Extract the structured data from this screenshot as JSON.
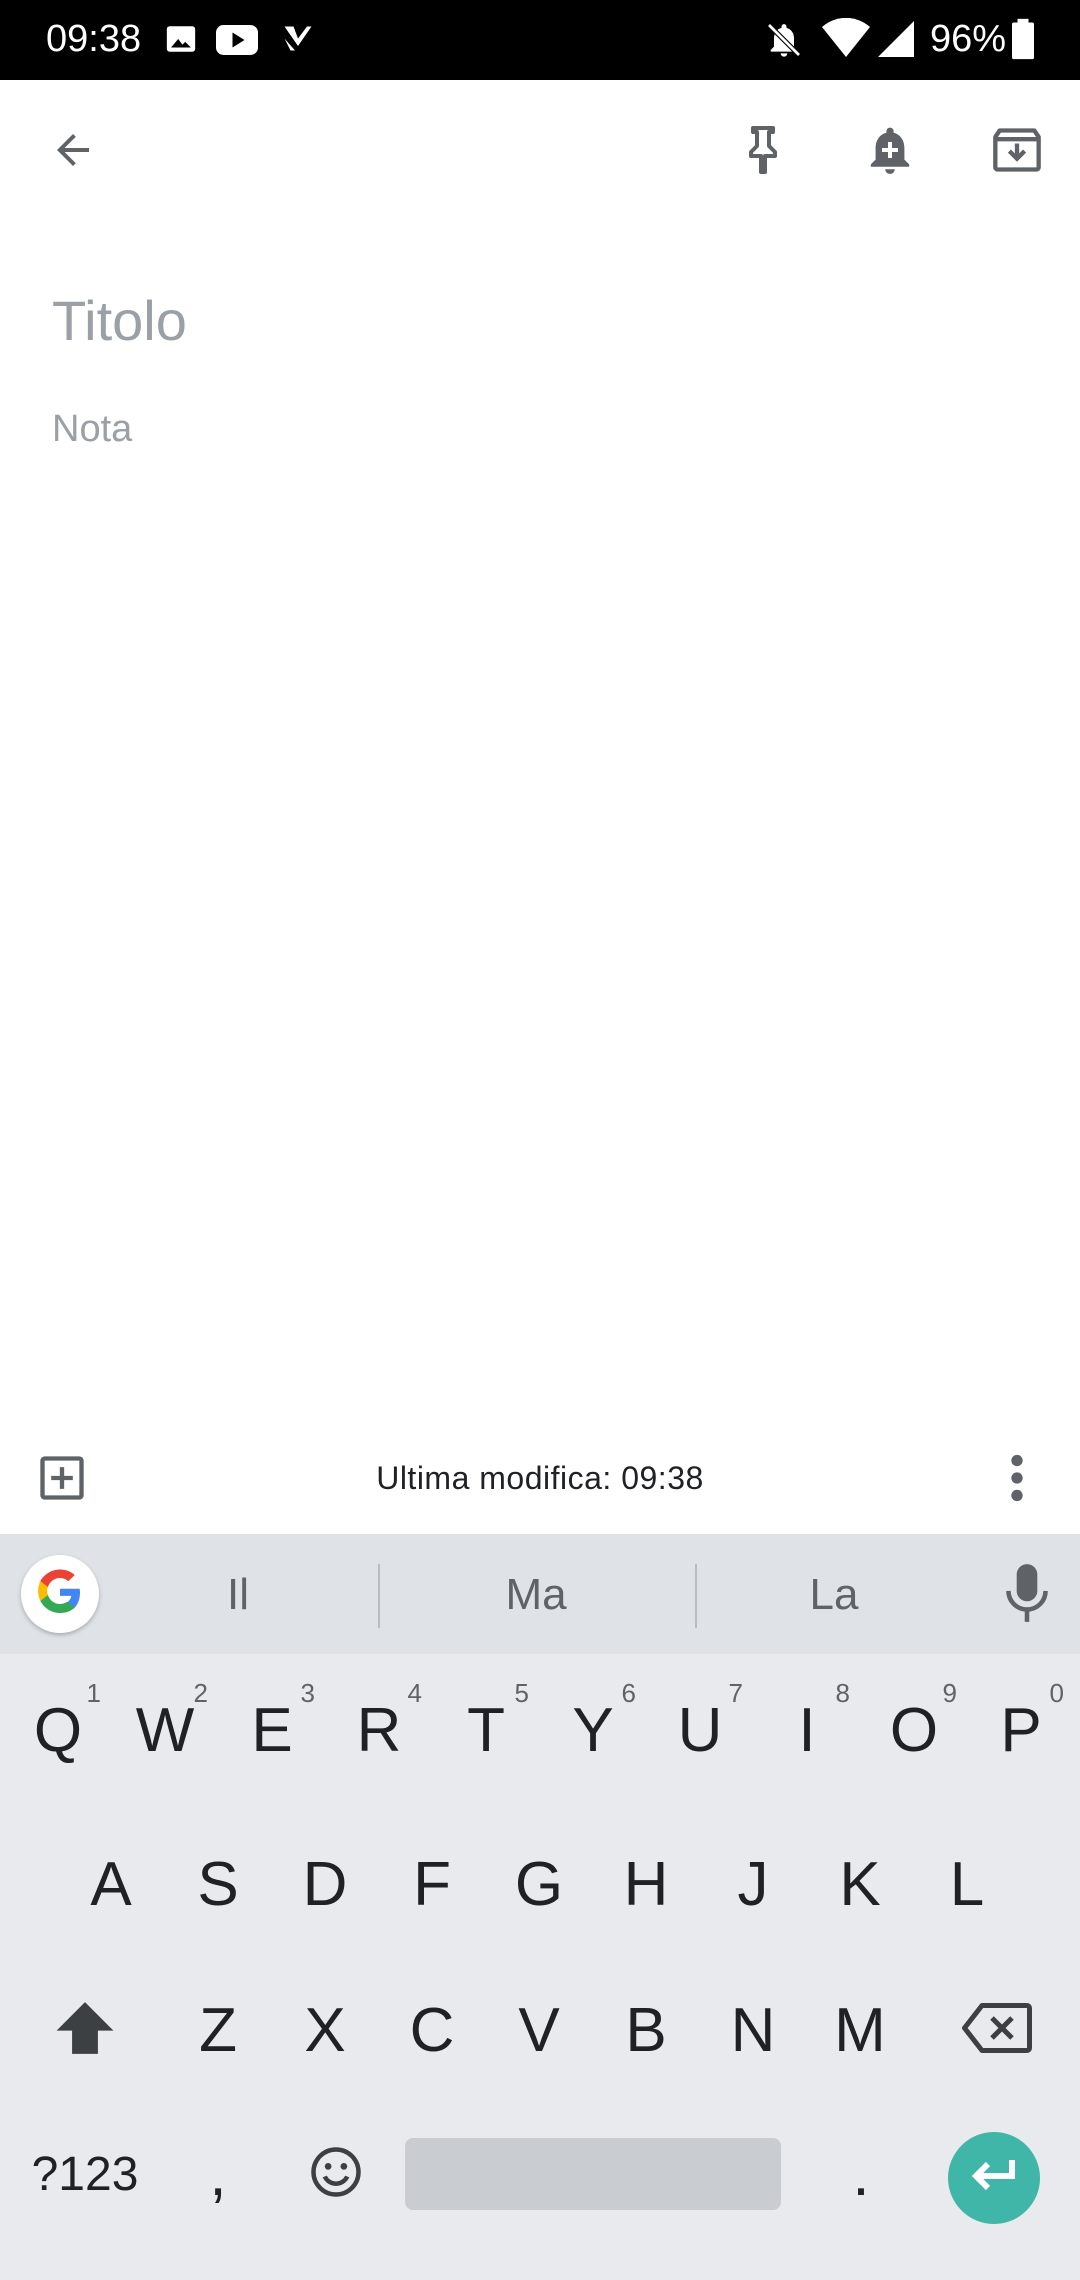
{
  "status_bar": {
    "time": "09:38",
    "battery_percent": "96%",
    "icons": [
      "image-icon",
      "youtube-icon",
      "check-icon",
      "bell-off-icon",
      "wifi-icon",
      "signal-icon",
      "battery-icon"
    ]
  },
  "app_bar": {
    "icons": [
      "back-arrow-icon",
      "pin-icon",
      "add-reminder-icon",
      "archive-icon"
    ]
  },
  "editor": {
    "title_placeholder": "Titolo",
    "note_placeholder": "Nota"
  },
  "bottom_bar": {
    "last_modified": "Ultima modifica: 09:38",
    "icons": [
      "add-box-icon",
      "more-vert-icon"
    ]
  },
  "keyboard": {
    "suggestions": [
      "Il",
      "Ma",
      "La"
    ],
    "row1": [
      {
        "key": "Q",
        "hint": "1"
      },
      {
        "key": "W",
        "hint": "2"
      },
      {
        "key": "E",
        "hint": "3"
      },
      {
        "key": "R",
        "hint": "4"
      },
      {
        "key": "T",
        "hint": "5"
      },
      {
        "key": "Y",
        "hint": "6"
      },
      {
        "key": "U",
        "hint": "7"
      },
      {
        "key": "I",
        "hint": "8"
      },
      {
        "key": "O",
        "hint": "9"
      },
      {
        "key": "P",
        "hint": "0"
      }
    ],
    "row2": [
      "A",
      "S",
      "D",
      "F",
      "G",
      "H",
      "J",
      "K",
      "L"
    ],
    "row3": [
      "Z",
      "X",
      "C",
      "V",
      "B",
      "N",
      "M"
    ],
    "symbols_label": "?123",
    "comma": ",",
    "period": ".",
    "accent_color": "#3fb6a8"
  }
}
